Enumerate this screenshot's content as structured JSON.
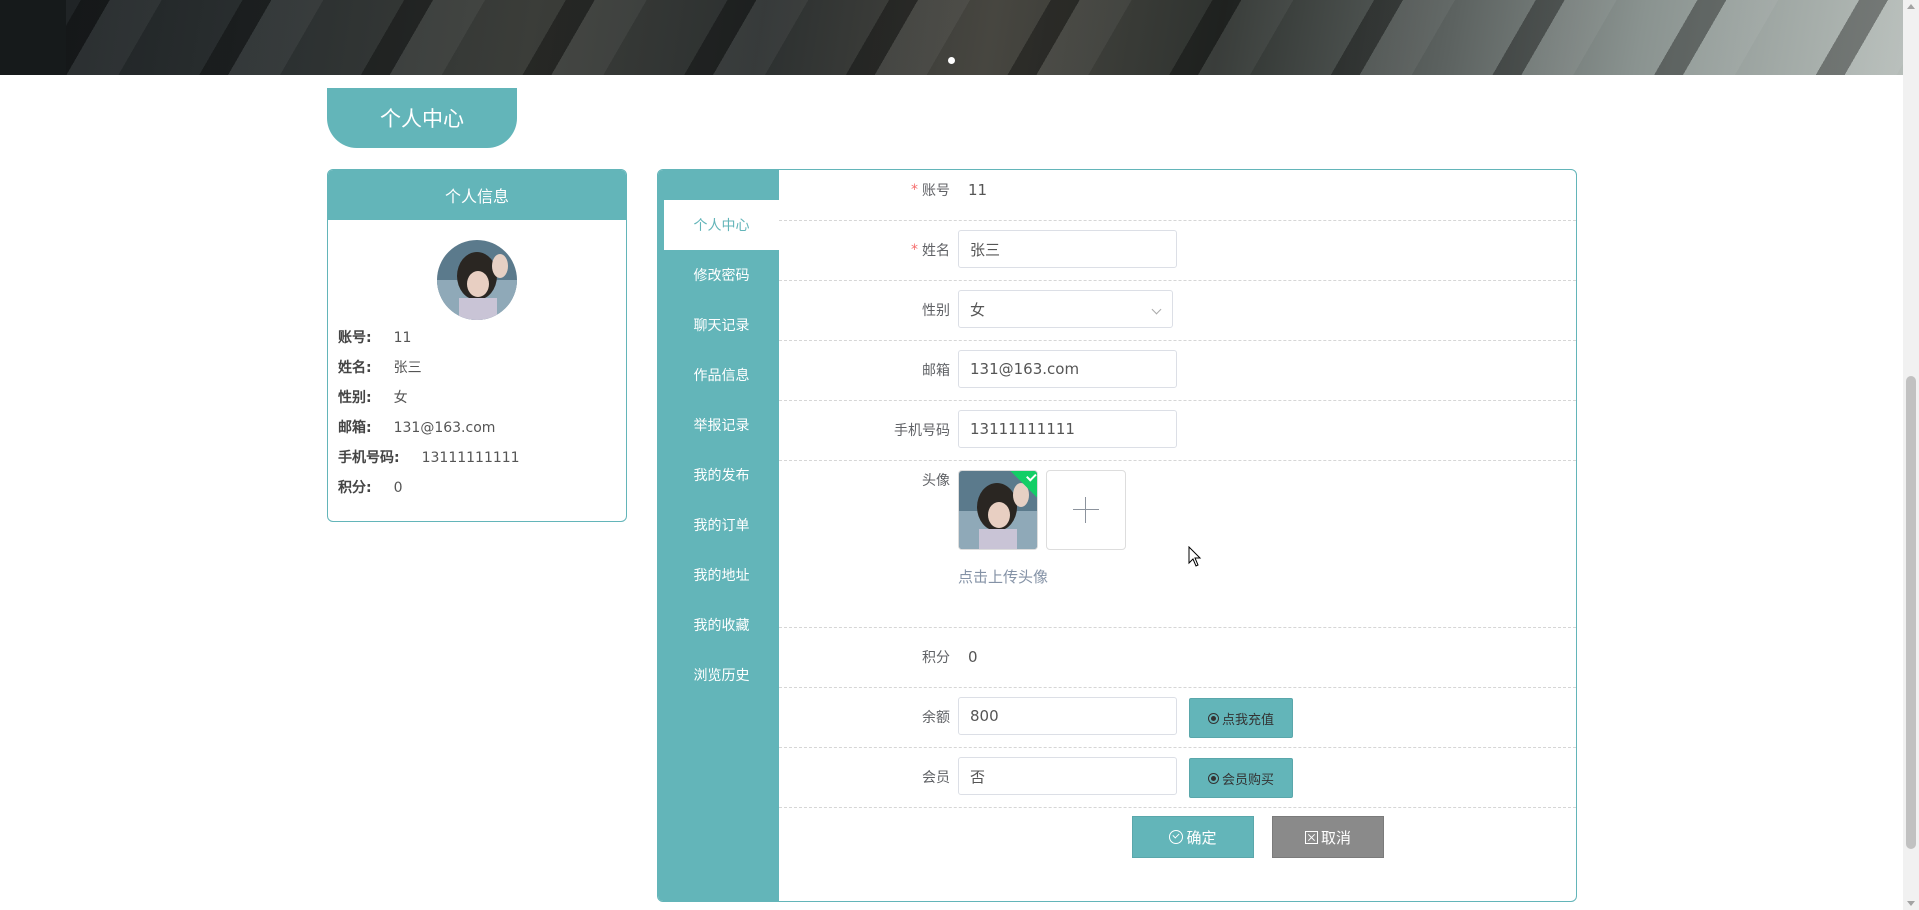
{
  "header": {
    "section_title": "个人中心"
  },
  "info_card": {
    "title": "个人信息",
    "rows": [
      {
        "label": "账号:",
        "value": "11"
      },
      {
        "label": "姓名:",
        "value": "张三"
      },
      {
        "label": "性别:",
        "value": "女"
      },
      {
        "label": "邮箱:",
        "value": "131@163.com"
      },
      {
        "label": "手机号码:",
        "value": "13111111111"
      },
      {
        "label": "积分:",
        "value": "0"
      }
    ]
  },
  "sidebar": {
    "items": [
      {
        "label": "个人中心",
        "active": true
      },
      {
        "label": "修改密码"
      },
      {
        "label": "聊天记录"
      },
      {
        "label": "作品信息"
      },
      {
        "label": "举报记录"
      },
      {
        "label": "我的发布"
      },
      {
        "label": "我的订单"
      },
      {
        "label": "我的地址"
      },
      {
        "label": "我的收藏"
      },
      {
        "label": "浏览历史"
      }
    ]
  },
  "form": {
    "required_mark": "*",
    "account": {
      "label": "账号",
      "value": "11"
    },
    "name": {
      "label": "姓名",
      "value": "张三"
    },
    "gender": {
      "label": "性别",
      "value": "女"
    },
    "email": {
      "label": "邮箱",
      "value": "131@163.com"
    },
    "phone": {
      "label": "手机号码",
      "value": "13111111111"
    },
    "avatar": {
      "label": "头像",
      "upload_tip": "点击上传头像"
    },
    "points": {
      "label": "积分",
      "value": "0"
    },
    "balance": {
      "label": "余额",
      "value": "800",
      "button": "点我充值"
    },
    "member": {
      "label": "会员",
      "value": "否",
      "button": "会员购买"
    },
    "submit_label": "确定",
    "cancel_label": "取消"
  },
  "colors": {
    "accent": "#63b5b9",
    "cancel": "#8a8a8a",
    "success": "#13ce66",
    "required": "#f56c6c"
  }
}
